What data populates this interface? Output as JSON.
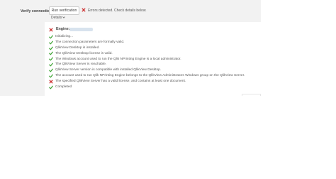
{
  "verify": {
    "label": "Verify connection",
    "button_label": "Run verification",
    "status_text": "Errors detected. Check details below.",
    "details_label": "Details"
  },
  "engine": {
    "label": "Engine:"
  },
  "checks": [
    {
      "status": "success",
      "text": "Initializing..."
    },
    {
      "status": "success",
      "text": "The connection parameters are formally valid."
    },
    {
      "status": "success",
      "text": "QlikView Desktop is installed."
    },
    {
      "status": "success",
      "text": "The QlikView Desktop license is valid."
    },
    {
      "status": "success",
      "text": "The Windows account used to run the Qlik NPrinting Engine is a local administrator."
    },
    {
      "status": "success",
      "text": "The QlikView Server is reachable."
    },
    {
      "status": "success",
      "text": "QlikView Server version is compatible with installed QlikView Desktop."
    },
    {
      "status": "success",
      "text": "The account used to run Qlik NPrinting Engine belongs to the QlikView Administrators Windows group on the QlikView Server."
    },
    {
      "status": "error",
      "text": "The specified QlikView Server has a valid license, and contains at least one document."
    },
    {
      "status": "success",
      "text": "Completed"
    }
  ],
  "colors": {
    "success": "#3fa535",
    "error": "#cc2e2e",
    "panel_background": "#f2f2f2"
  },
  "icons": {
    "success": "check-icon",
    "error": "close-icon",
    "details": "chevron-down-icon"
  }
}
